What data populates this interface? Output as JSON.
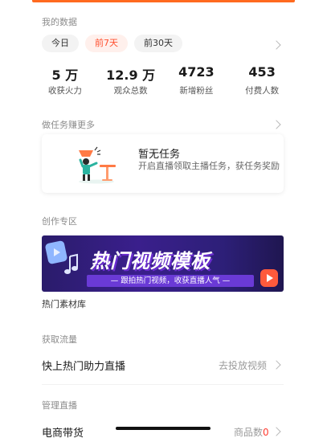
{
  "colors": {
    "accent": "#ff4f2e",
    "brand_orange": "#ff6a1f",
    "banner_purple": "#3a1f8c"
  },
  "my_data": {
    "title": "我的数据",
    "tabs": [
      {
        "label": "今日",
        "active": false
      },
      {
        "label": "前7天",
        "active": true
      },
      {
        "label": "前30天",
        "active": false
      }
    ],
    "stats": [
      {
        "value": "5 万",
        "label": "收获火力"
      },
      {
        "value": "12.9 万",
        "label": "观众总数"
      },
      {
        "value": "4723",
        "label": "新增粉丝"
      },
      {
        "value": "453",
        "label": "付费人数"
      }
    ]
  },
  "tasks": {
    "title": "做任务赚更多",
    "card_title": "暂无任务",
    "card_desc": "开启直播领取主播任务，获任务奖励"
  },
  "creation": {
    "title": "创作专区",
    "banner_title": "热门视频模板",
    "banner_subtitle": "— 跟拍热门视频，收获直播人气 —",
    "material_label": "热门素材库"
  },
  "traffic": {
    "title": "获取流量",
    "row_label": "快上热门助力直播",
    "row_action": "去投放视频"
  },
  "manage": {
    "title": "管理直播",
    "row_label": "电商带货",
    "row_meta_label": "商品数",
    "row_meta_value": "0"
  }
}
